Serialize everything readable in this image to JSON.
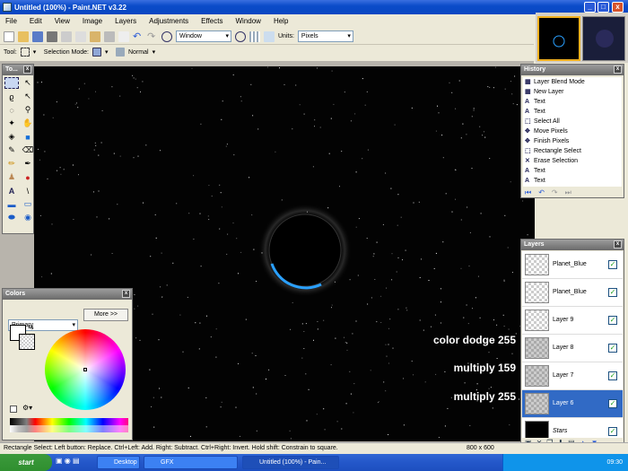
{
  "window": {
    "title": "Untitled (100%) - Paint.NET v3.22",
    "min": "_",
    "max": "□",
    "close": "x"
  },
  "menu": [
    "File",
    "Edit",
    "View",
    "Image",
    "Layers",
    "Adjustments",
    "Effects",
    "Window",
    "Help"
  ],
  "toolbar": {
    "zoom_value": "Window",
    "units_label": "Units:",
    "units_value": "Pixels"
  },
  "toolbar2": {
    "tool_label": "Tool:",
    "selection_mode_label": "Selection Mode:",
    "blend_value": "Normal"
  },
  "tools_panel": {
    "title": "To..."
  },
  "colors_panel": {
    "title": "Colors",
    "mode_value": "Primary",
    "more_label": "More >>"
  },
  "history": {
    "title": "History",
    "items": [
      {
        "icon": "layer-blend-icon",
        "glyph": "▦",
        "label": "Layer Blend Mode"
      },
      {
        "icon": "new-layer-icon",
        "glyph": "▦",
        "label": "New Layer"
      },
      {
        "icon": "text-icon",
        "glyph": "A",
        "label": "Text"
      },
      {
        "icon": "text-icon",
        "glyph": "A",
        "label": "Text"
      },
      {
        "icon": "select-all-icon",
        "glyph": "⬚",
        "label": "Select All"
      },
      {
        "icon": "move-pixels-icon",
        "glyph": "✥",
        "label": "Move Pixels"
      },
      {
        "icon": "finish-pixels-icon",
        "glyph": "✥",
        "label": "Finish Pixels"
      },
      {
        "icon": "rectangle-select-icon",
        "glyph": "⬚",
        "label": "Rectangle Select"
      },
      {
        "icon": "erase-selection-icon",
        "glyph": "✕",
        "label": "Erase Selection"
      },
      {
        "icon": "text-icon",
        "glyph": "A",
        "label": "Text"
      },
      {
        "icon": "text-icon",
        "glyph": "A",
        "label": "Text"
      }
    ]
  },
  "layers": {
    "title": "Layers",
    "items": [
      {
        "label": "Planet_Blue",
        "visible": "✓"
      },
      {
        "label": "Planet_Blue",
        "visible": "✓"
      },
      {
        "label": "Layer 9",
        "visible": "✓"
      },
      {
        "label": "Layer 8",
        "visible": "✓"
      },
      {
        "label": "Layer 7",
        "visible": "✓"
      },
      {
        "label": "Layer 6",
        "visible": "✓"
      },
      {
        "label": "Stars",
        "visible": "✓"
      }
    ]
  },
  "annotations": {
    "a1": "color dodge 255",
    "a2": "multiply 159",
    "a3": "multiply 255"
  },
  "status": {
    "hint": "Rectangle Select: Left button: Replace. Ctrl+Left: Add. Right: Subtract. Ctrl+Right: Invert. Hold shift: Constrain to square.",
    "size": "800 x 600"
  },
  "taskbar": {
    "start": "start",
    "desktop": "Desktop",
    "gfx": "GFX",
    "paintnet": "Untitled (100%) - Pain...",
    "clock": "09:30"
  },
  "colors": {
    "accent": "#316ac5",
    "planet_rim": "#2aa0ff",
    "canvas_bg": "#030303"
  }
}
